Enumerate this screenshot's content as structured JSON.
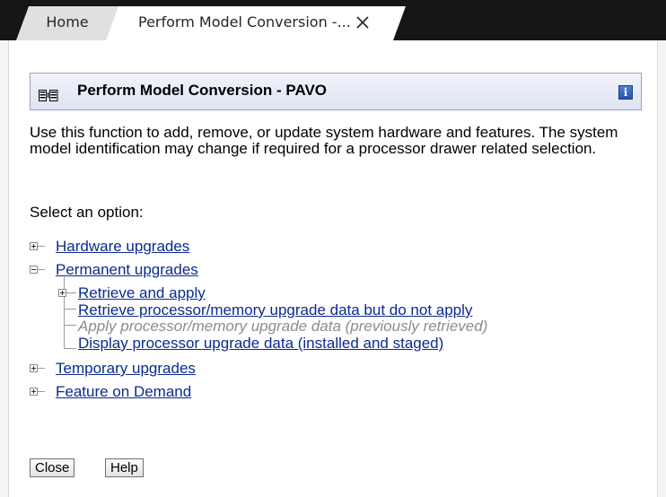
{
  "tabs": [
    {
      "label": "Home",
      "active": false
    },
    {
      "label": "Perform Model Conversion -...",
      "active": true
    }
  ],
  "panel": {
    "title": "Perform Model Conversion - PAVO",
    "info_icon_label": "i",
    "description": "Use this function to add, remove, or update system hardware and features. The system model identification may change if required for a processor drawer related selection.",
    "select_label": "Select an option:"
  },
  "tree": {
    "hardware_upgrades": "Hardware upgrades",
    "permanent_upgrades": "Permanent upgrades",
    "retrieve_and_apply": "Retrieve and apply",
    "retrieve_no_apply": "Retrieve processor/memory upgrade data but do not apply",
    "apply_previous": "Apply processor/memory upgrade data (previously retrieved)",
    "display_upgrade": "Display processor upgrade data (installed and staged)",
    "temporary_upgrades": "Temporary upgrades",
    "feature_on_demand": "Feature on Demand"
  },
  "buttons": {
    "close": "Close",
    "help": "Help"
  },
  "icons": {
    "tab_close": "close-icon",
    "title": "hardware-frame-icon",
    "info": "info-icon",
    "expand": "expand-plus-icon",
    "collapse": "collapse-minus-icon"
  },
  "colors": {
    "tabbar_bg": "#161616",
    "link": "#0b2a8f",
    "disabled": "#8c8c8c",
    "titlebar_border": "#97a3c2"
  }
}
